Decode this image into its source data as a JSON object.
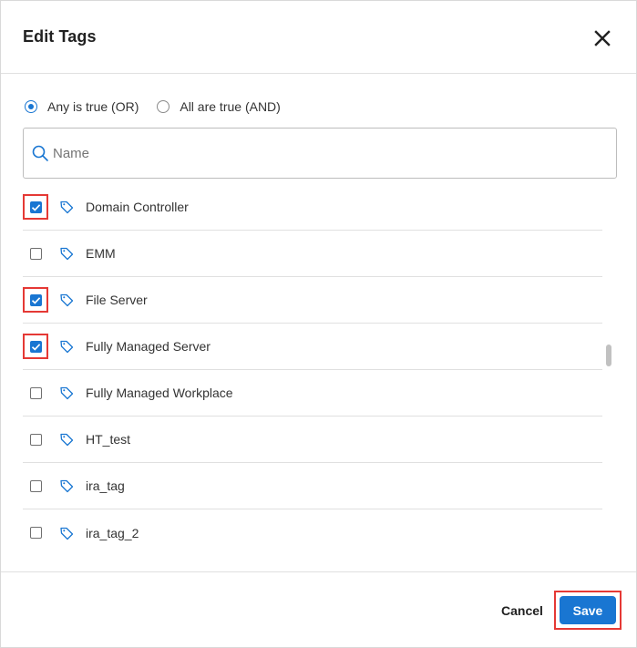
{
  "dialog": {
    "title": "Edit Tags"
  },
  "filter_mode": {
    "options": [
      {
        "label": "Any is true (OR)",
        "selected": true
      },
      {
        "label": "All are true (AND)",
        "selected": false
      }
    ]
  },
  "search": {
    "placeholder": "Name",
    "value": ""
  },
  "tags": [
    {
      "label": "Domain Controller",
      "checked": true,
      "highlighted": true
    },
    {
      "label": "EMM",
      "checked": false,
      "highlighted": false
    },
    {
      "label": "File Server",
      "checked": true,
      "highlighted": true
    },
    {
      "label": "Fully Managed Server",
      "checked": true,
      "highlighted": true
    },
    {
      "label": "Fully Managed Workplace",
      "checked": false,
      "highlighted": false
    },
    {
      "label": "HT_test",
      "checked": false,
      "highlighted": false
    },
    {
      "label": "ira_tag",
      "checked": false,
      "highlighted": false
    },
    {
      "label": "ira_tag_2",
      "checked": false,
      "highlighted": false
    }
  ],
  "footer": {
    "cancel_label": "Cancel",
    "save_label": "Save"
  },
  "colors": {
    "accent": "#1976d2",
    "highlight": "#e53935"
  },
  "icons": {
    "close": "close-icon",
    "search": "search-icon",
    "tag": "tag-icon",
    "check": "check-icon"
  }
}
